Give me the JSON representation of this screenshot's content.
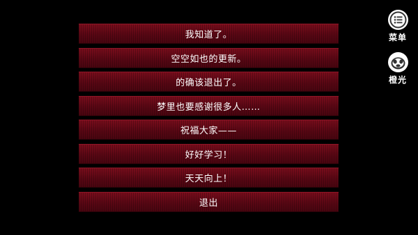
{
  "choices": [
    "我知道了。",
    "空空如也的更新。",
    "的确该退出了。",
    "梦里也要感谢很多人……",
    "祝福大家——",
    "好好学习！",
    "天天向上！",
    "退出"
  ],
  "side": {
    "menu_label": "菜单",
    "menu_icon": "menu-list-icon",
    "light_label": "橙光",
    "light_icon": "chengguang-logo-icon"
  },
  "colors": {
    "background": "#000000",
    "choice_bar": "#5a0714",
    "text": "#ffffff"
  }
}
